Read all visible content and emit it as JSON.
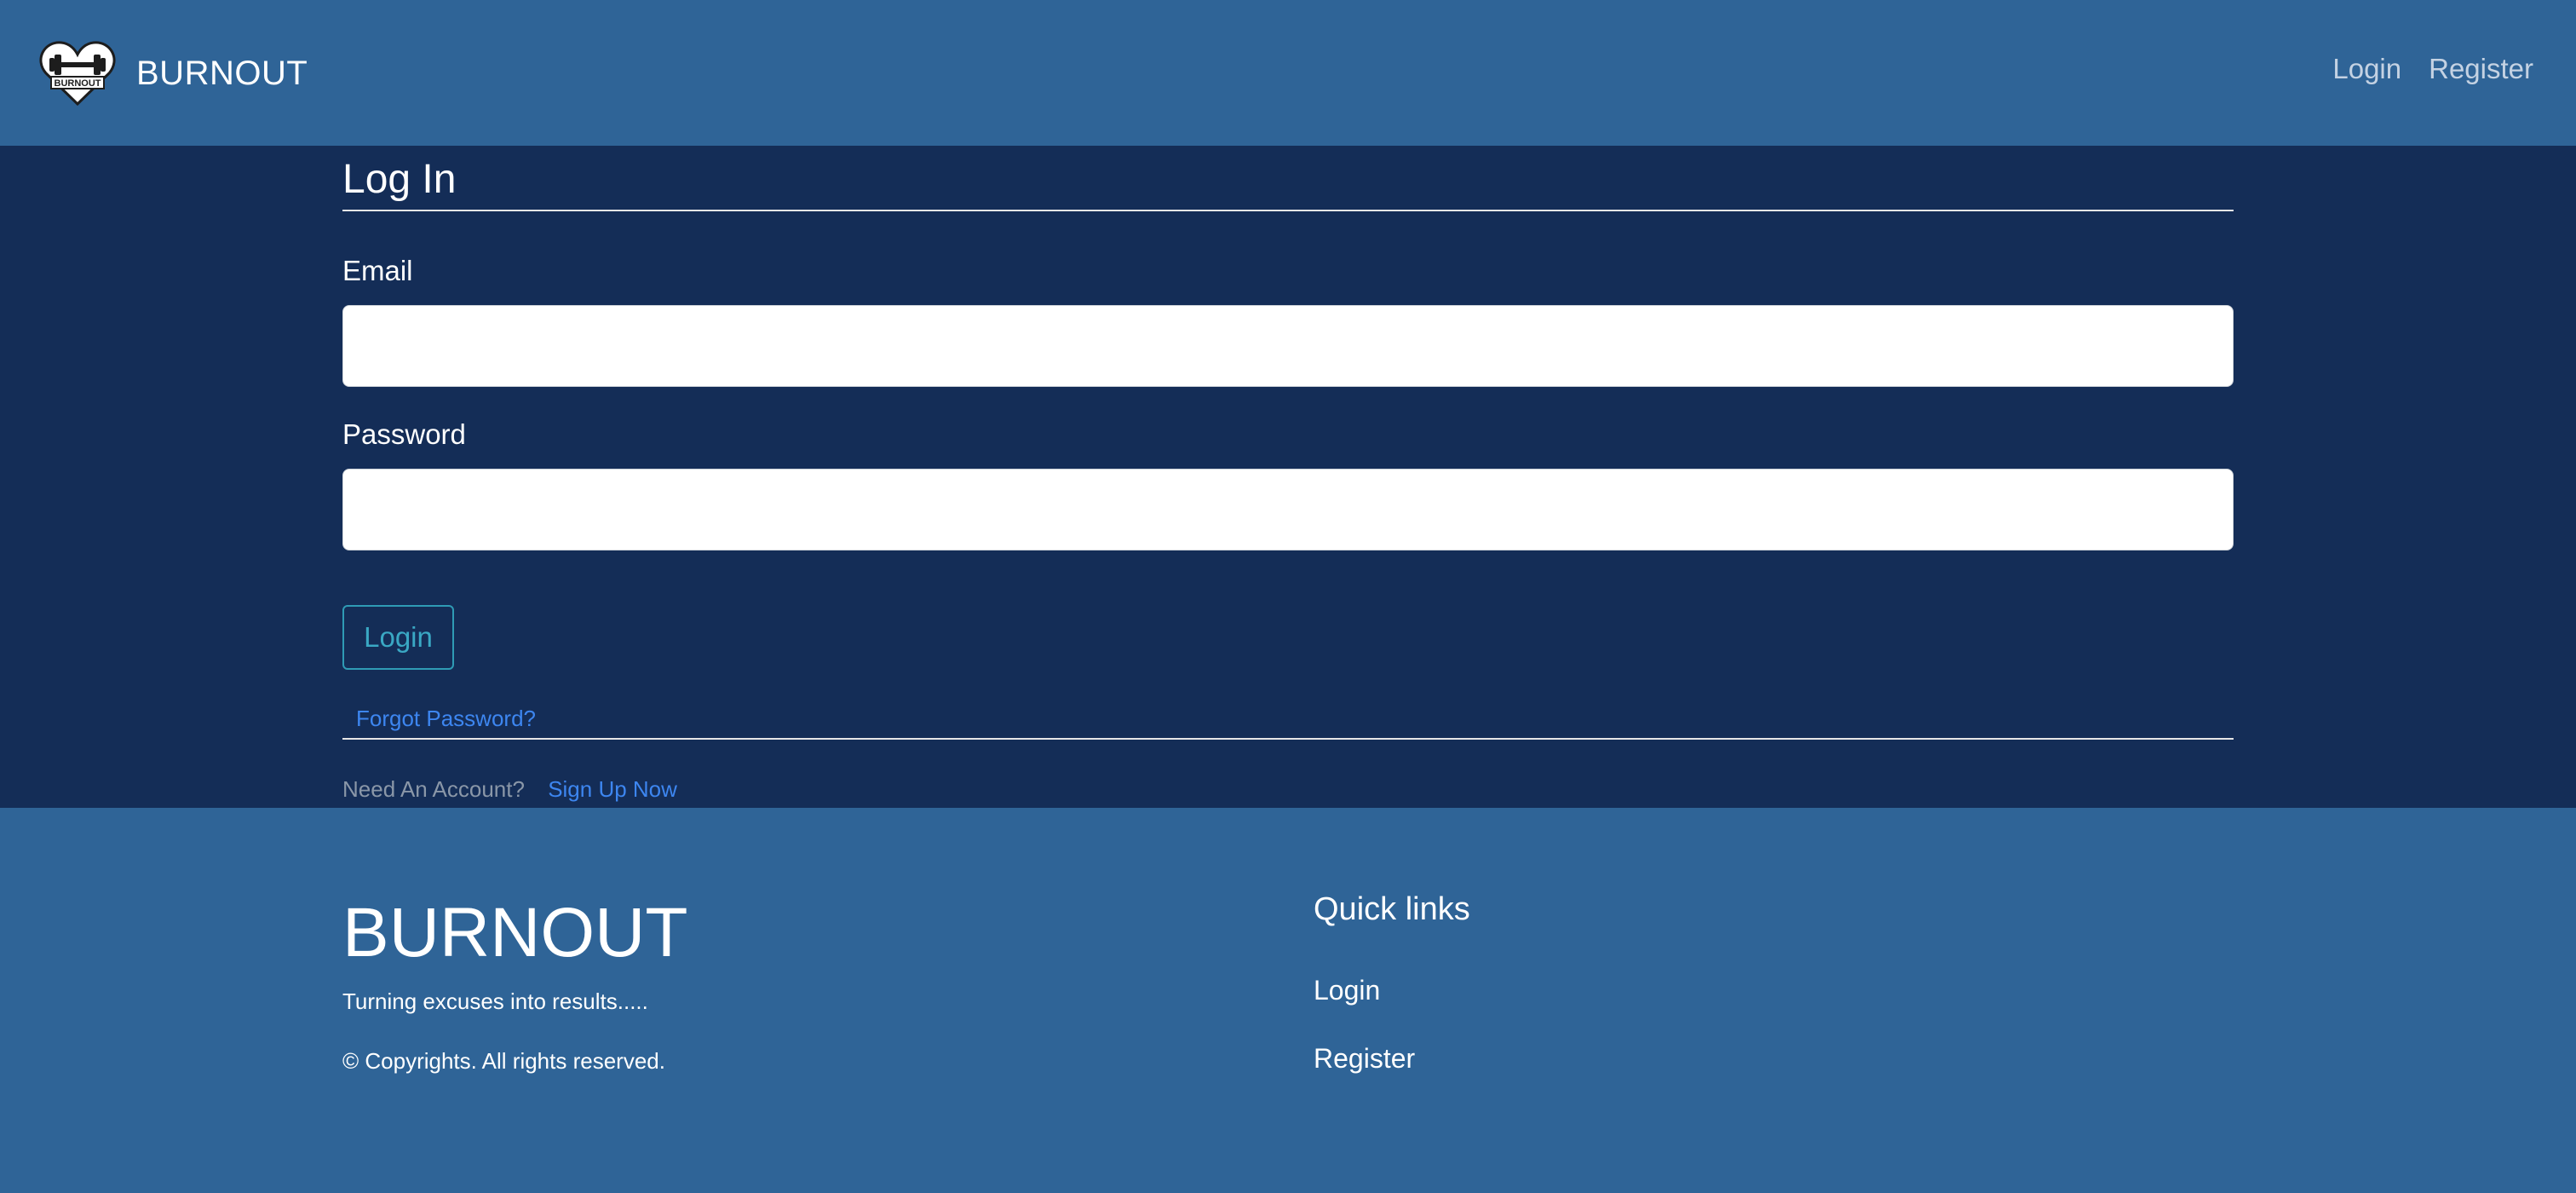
{
  "header": {
    "brand": "BURNOUT",
    "logo_icon": "heart-dumbbell-logo",
    "logo_text": "BURNOUT",
    "nav": [
      {
        "label": "Login"
      },
      {
        "label": "Register"
      }
    ]
  },
  "login_form": {
    "title": "Log In",
    "email_label": "Email",
    "email_value": "",
    "email_placeholder": "",
    "password_label": "Password",
    "password_value": "",
    "password_placeholder": "",
    "submit_label": "Login",
    "forgot_label": "Forgot Password?",
    "need_account_text": "Need An Account?",
    "signup_label": "Sign Up Now"
  },
  "footer": {
    "brand": "BURNOUT",
    "tagline": "Turning excuses into results.....",
    "copyright": "© Copyrights. All rights reserved.",
    "quick_links_title": "Quick links",
    "quick_links": [
      {
        "label": "Login"
      },
      {
        "label": "Register"
      }
    ]
  },
  "colors": {
    "header_bg": "#2f6497",
    "main_bg": "#142d57",
    "footer_bg": "#2f6497",
    "link_blue": "#3d86f0",
    "button_accent": "#3aa8c4"
  }
}
